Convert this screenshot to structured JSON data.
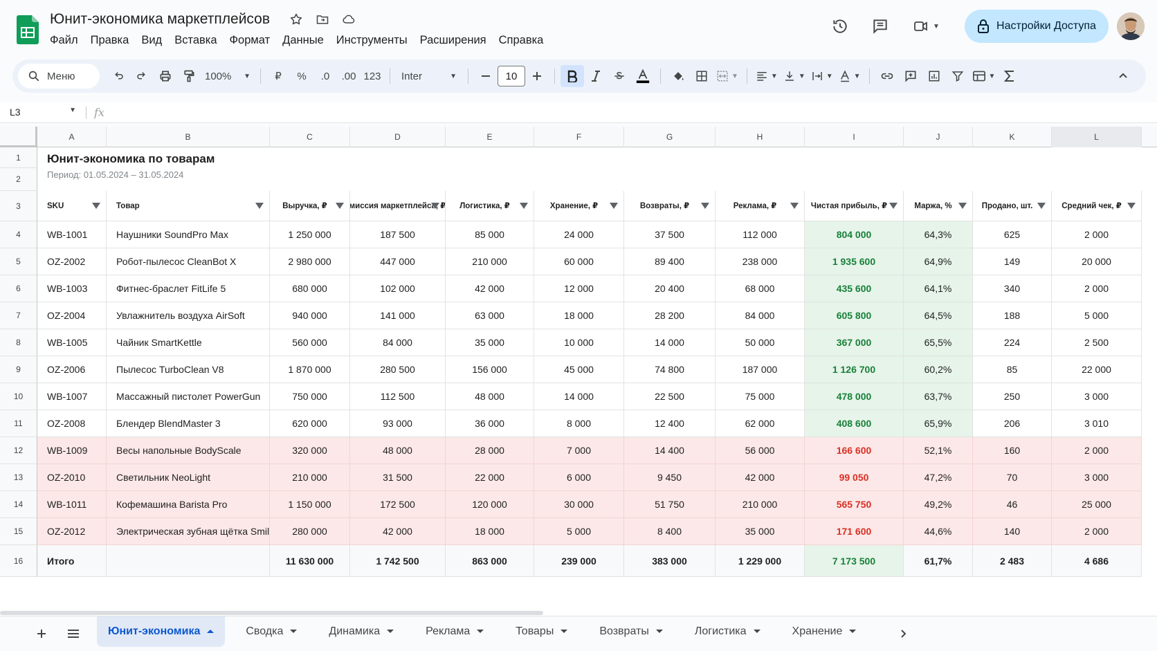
{
  "doc": {
    "title": "Юнит-экономика маркетплейсов",
    "menu": [
      "Файл",
      "Правка",
      "Вид",
      "Вставка",
      "Формат",
      "Данные",
      "Инструменты",
      "Расширения",
      "Справка"
    ],
    "share_label": "Настройки Доступа"
  },
  "toolbar": {
    "search_label": "Меню",
    "zoom": "100%",
    "currency": "₽",
    "percent": "%",
    "dec_minus": ".0",
    "dec_plus": ".00",
    "number_format": "123",
    "font": "Inter",
    "font_size": "10"
  },
  "formula": {
    "cell_ref": "L3",
    "fx": "fx",
    "value": ""
  },
  "sheet": {
    "title": "Юнит-экономика по товарам",
    "subtitle": "Период: 01.05.2024 – 31.05.2024",
    "col_letters": [
      "A",
      "B",
      "C",
      "D",
      "E",
      "F",
      "G",
      "H",
      "I",
      "J",
      "K",
      "L"
    ],
    "row_numbers": [
      "1",
      "2",
      "3",
      "4",
      "5",
      "6",
      "7",
      "8",
      "9",
      "10",
      "11",
      "12",
      "13",
      "14",
      "15",
      "16"
    ],
    "headers": [
      "SKU",
      "Товар",
      "Выручка, ₽",
      "Комиссия маркетплейса, ₽",
      "Логистика, ₽",
      "Хранение, ₽",
      "Возвраты, ₽",
      "Реклама, ₽",
      "Чистая прибыль, ₽",
      "Маржа, %",
      "Продано, шт.",
      "Средний чек, ₽"
    ],
    "rows": [
      {
        "sku": "WB-1001",
        "name": "Наушники SoundPro Max",
        "rev": "1 250 000",
        "comm": "187 500",
        "log": "85 000",
        "stor": "24 000",
        "ret": "37 500",
        "ads": "112 000",
        "profit": "804 000",
        "margin": "64,3%",
        "sold": "625",
        "avg": "2 000",
        "status": "good"
      },
      {
        "sku": "OZ-2002",
        "name": "Робот-пылесос CleanBot X",
        "rev": "2 980 000",
        "comm": "447 000",
        "log": "210 000",
        "stor": "60 000",
        "ret": "89 400",
        "ads": "238 000",
        "profit": "1 935 600",
        "margin": "64,9%",
        "sold": "149",
        "avg": "20 000",
        "status": "good"
      },
      {
        "sku": "WB-1003",
        "name": "Фитнес-браслет FitLife 5",
        "rev": "680 000",
        "comm": "102 000",
        "log": "42 000",
        "stor": "12 000",
        "ret": "20 400",
        "ads": "68 000",
        "profit": "435 600",
        "margin": "64,1%",
        "sold": "340",
        "avg": "2 000",
        "status": "good"
      },
      {
        "sku": "OZ-2004",
        "name": "Увлажнитель воздуха AirSoft",
        "rev": "940 000",
        "comm": "141 000",
        "log": "63 000",
        "stor": "18 000",
        "ret": "28 200",
        "ads": "84 000",
        "profit": "605 800",
        "margin": "64,5%",
        "sold": "188",
        "avg": "5 000",
        "status": "good"
      },
      {
        "sku": "WB-1005",
        "name": "Чайник SmartKettle",
        "rev": "560 000",
        "comm": "84 000",
        "log": "35 000",
        "stor": "10 000",
        "ret": "14 000",
        "ads": "50 000",
        "profit": "367 000",
        "margin": "65,5%",
        "sold": "224",
        "avg": "2 500",
        "status": "good"
      },
      {
        "sku": "OZ-2006",
        "name": "Пылесос TurboClean V8",
        "rev": "1 870 000",
        "comm": "280 500",
        "log": "156 000",
        "stor": "45 000",
        "ret": "74 800",
        "ads": "187 000",
        "profit": "1 126 700",
        "margin": "60,2%",
        "sold": "85",
        "avg": "22 000",
        "status": "good"
      },
      {
        "sku": "WB-1007",
        "name": "Массажный пистолет PowerGun",
        "rev": "750 000",
        "comm": "112 500",
        "log": "48 000",
        "stor": "14 000",
        "ret": "22 500",
        "ads": "75 000",
        "profit": "478 000",
        "margin": "63,7%",
        "sold": "250",
        "avg": "3 000",
        "status": "good"
      },
      {
        "sku": "OZ-2008",
        "name": "Блендер BlendMaster 3",
        "rev": "620 000",
        "comm": "93 000",
        "log": "36 000",
        "stor": "8 000",
        "ret": "12 400",
        "ads": "62 000",
        "profit": "408 600",
        "margin": "65,9%",
        "sold": "206",
        "avg": "3 010",
        "status": "good"
      },
      {
        "sku": "WB-1009",
        "name": "Весы напольные BodyScale",
        "rev": "320 000",
        "comm": "48 000",
        "log": "28 000",
        "stor": "7 000",
        "ret": "14 400",
        "ads": "56 000",
        "profit": "166 600",
        "margin": "52,1%",
        "sold": "160",
        "avg": "2 000",
        "status": "bad"
      },
      {
        "sku": "OZ-2010",
        "name": "Светильник NeoLight",
        "rev": "210 000",
        "comm": "31 500",
        "log": "22 000",
        "stor": "6 000",
        "ret": "9 450",
        "ads": "42 000",
        "profit": "99 050",
        "margin": "47,2%",
        "sold": "70",
        "avg": "3 000",
        "status": "bad"
      },
      {
        "sku": "WB-1011",
        "name": "Кофемашина Barista Pro",
        "rev": "1 150 000",
        "comm": "172 500",
        "log": "120 000",
        "stor": "30 000",
        "ret": "51 750",
        "ads": "210 000",
        "profit": "565 750",
        "margin": "49,2%",
        "sold": "46",
        "avg": "25 000",
        "status": "bad"
      },
      {
        "sku": "OZ-2012",
        "name": "Электрическая зубная щётка SmileX",
        "rev": "280 000",
        "comm": "42 000",
        "log": "18 000",
        "stor": "5 000",
        "ret": "8 400",
        "ads": "35 000",
        "profit": "171 600",
        "margin": "44,6%",
        "sold": "140",
        "avg": "2 000",
        "status": "bad"
      }
    ],
    "total": {
      "label": "Итого",
      "rev": "11 630 000",
      "comm": "1 742 500",
      "log": "863 000",
      "stor": "239 000",
      "ret": "383 000",
      "ads": "1 229 000",
      "profit": "7 173 500",
      "margin": "61,7%",
      "sold": "2 483",
      "avg": "4 686"
    }
  },
  "tabs": [
    {
      "label": "Юнит-экономика",
      "active": true
    },
    {
      "label": "Сводка"
    },
    {
      "label": "Динамика"
    },
    {
      "label": "Реклама"
    },
    {
      "label": "Товары"
    },
    {
      "label": "Возвраты"
    },
    {
      "label": "Логистика"
    },
    {
      "label": "Хранение"
    }
  ],
  "colors": {
    "accent": "#0b57d0",
    "share_bg": "#c2e7ff",
    "positive": "#188038",
    "positive_bg": "#e6f4ea",
    "negative": "#d93025",
    "negative_bg": "#fce8e8"
  }
}
